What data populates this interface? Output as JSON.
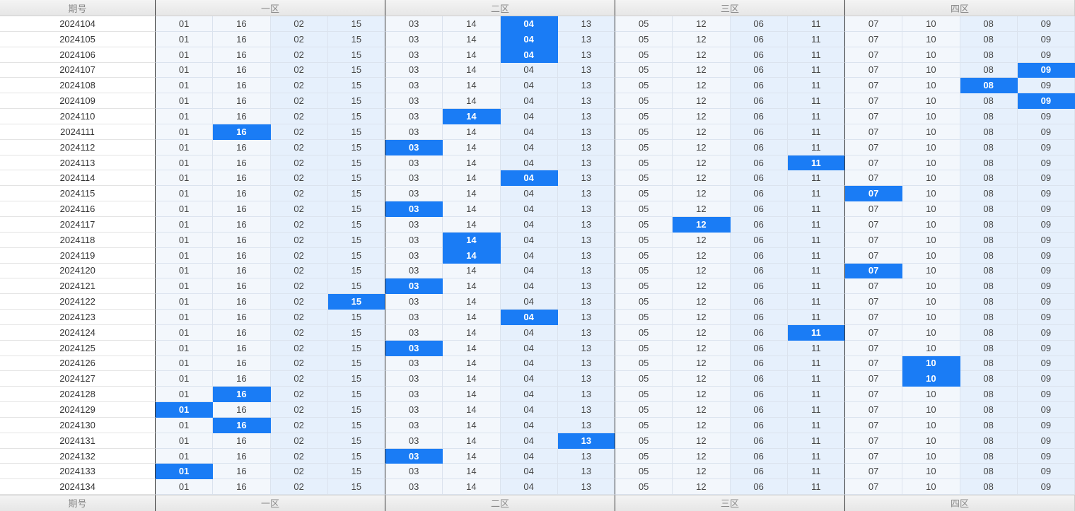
{
  "header": {
    "period_label": "期号",
    "zones": [
      "一区",
      "二区",
      "三区",
      "四区"
    ]
  },
  "footer": {
    "period_label": "期号",
    "zones": [
      "一区",
      "二区",
      "三区",
      "四区"
    ]
  },
  "columns": [
    "01",
    "16",
    "02",
    "15",
    "03",
    "14",
    "04",
    "13",
    "05",
    "12",
    "06",
    "11",
    "07",
    "10",
    "08",
    "09"
  ],
  "rows": [
    {
      "period": "2024104",
      "hits": [
        6
      ]
    },
    {
      "period": "2024105",
      "hits": [
        6
      ]
    },
    {
      "period": "2024106",
      "hits": [
        6
      ]
    },
    {
      "period": "2024107",
      "hits": [
        15
      ]
    },
    {
      "period": "2024108",
      "hits": [
        14
      ]
    },
    {
      "period": "2024109",
      "hits": [
        15
      ]
    },
    {
      "period": "2024110",
      "hits": [
        5
      ]
    },
    {
      "period": "2024111",
      "hits": [
        1
      ]
    },
    {
      "period": "2024112",
      "hits": [
        4
      ]
    },
    {
      "period": "2024113",
      "hits": [
        11
      ]
    },
    {
      "period": "2024114",
      "hits": [
        6
      ]
    },
    {
      "period": "2024115",
      "hits": [
        12
      ]
    },
    {
      "period": "2024116",
      "hits": [
        4
      ]
    },
    {
      "period": "2024117",
      "hits": [
        9
      ]
    },
    {
      "period": "2024118",
      "hits": [
        5
      ]
    },
    {
      "period": "2024119",
      "hits": [
        5
      ]
    },
    {
      "period": "2024120",
      "hits": [
        12
      ]
    },
    {
      "period": "2024121",
      "hits": [
        4
      ]
    },
    {
      "period": "2024122",
      "hits": [
        3
      ]
    },
    {
      "period": "2024123",
      "hits": [
        6
      ]
    },
    {
      "period": "2024124",
      "hits": [
        11
      ]
    },
    {
      "period": "2024125",
      "hits": [
        4
      ]
    },
    {
      "period": "2024126",
      "hits": [
        13
      ]
    },
    {
      "period": "2024127",
      "hits": [
        13
      ]
    },
    {
      "period": "2024128",
      "hits": [
        1
      ]
    },
    {
      "period": "2024129",
      "hits": [
        0
      ]
    },
    {
      "period": "2024130",
      "hits": [
        1
      ]
    },
    {
      "period": "2024131",
      "hits": [
        7
      ]
    },
    {
      "period": "2024132",
      "hits": [
        4
      ]
    },
    {
      "period": "2024133",
      "hits": [
        0
      ]
    },
    {
      "period": "2024134",
      "hits": []
    }
  ],
  "colors": {
    "highlight": "#1a7cf5",
    "cell_light": "#f3f7fc",
    "cell_tint": "#e6f0fc",
    "zone_divider": "#333333"
  }
}
